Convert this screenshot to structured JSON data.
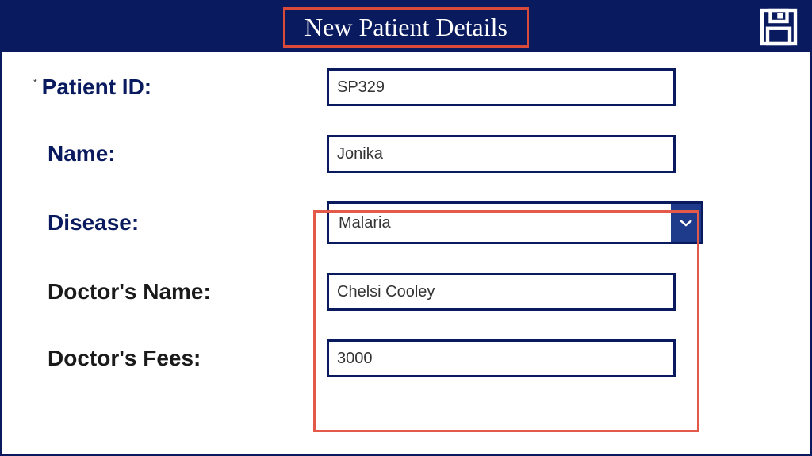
{
  "header": {
    "title": "New Patient Details"
  },
  "form": {
    "patient_id": {
      "label": "Patient ID:",
      "value": "SP329"
    },
    "name": {
      "label": "Name:",
      "value": "Jonika"
    },
    "disease": {
      "label": "Disease:",
      "value": "Malaria"
    },
    "doctor_name": {
      "label": "Doctor's Name:",
      "value": "Chelsi Cooley"
    },
    "doctor_fees": {
      "label": "Doctor's Fees:",
      "value": "3000"
    }
  },
  "colors": {
    "primary": "#0a1a5e",
    "highlight": "#e35a4a"
  }
}
